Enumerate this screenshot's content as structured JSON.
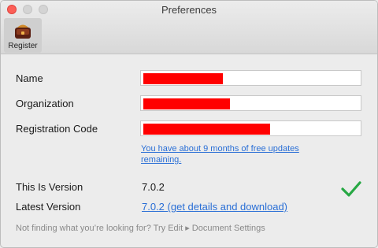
{
  "window": {
    "title": "Preferences"
  },
  "toolbar": {
    "items": [
      {
        "label": "Register",
        "icon": "register-icon"
      }
    ]
  },
  "form": {
    "name_label": "Name",
    "organization_label": "Organization",
    "registration_code_label": "Registration Code"
  },
  "updates_note": "You have about 9 months of free updates remaining.",
  "version": {
    "this_label": "This Is Version",
    "this_value": "7.0.2",
    "latest_label": "Latest Version",
    "latest_link": "7.0.2 (get details and download)",
    "status_icon": "checkmark-icon"
  },
  "footer_hint": "Not finding what you’re looking for? Try Edit ▸ Document Settings",
  "colors": {
    "accent": "#2a6fd6",
    "check": "#27a844",
    "redaction": "#ff0000"
  }
}
